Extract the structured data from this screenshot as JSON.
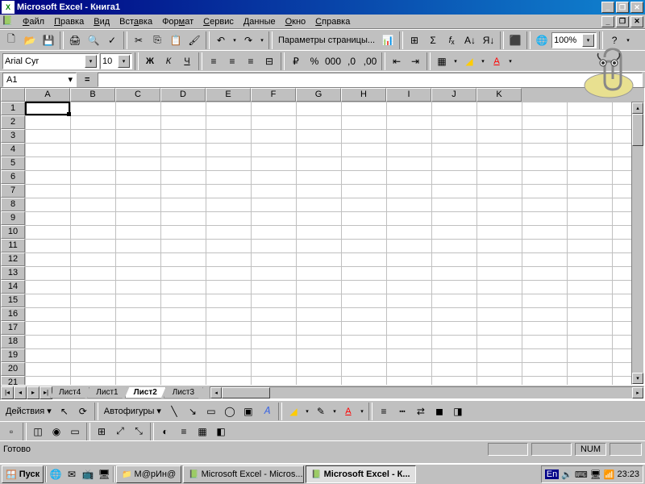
{
  "title": "Microsoft Excel - Книга1",
  "menus": [
    "Файл",
    "Правка",
    "Вид",
    "Вставка",
    "Формат",
    "Сервис",
    "Данные",
    "Окно",
    "Справка"
  ],
  "pageParams": "Параметры страницы...",
  "zoom": "100%",
  "font": {
    "name": "Arial Cyr",
    "size": "10"
  },
  "namebox": "A1",
  "columns": [
    "A",
    "B",
    "C",
    "D",
    "E",
    "F",
    "G",
    "H",
    "I",
    "J",
    "K"
  ],
  "rows": [
    "1",
    "2",
    "3",
    "4",
    "5",
    "6",
    "7",
    "8",
    "9",
    "10",
    "11",
    "12",
    "13",
    "14",
    "15",
    "16",
    "17",
    "18",
    "19",
    "20",
    "21"
  ],
  "sheets": [
    "Лист4",
    "Лист1",
    "Лист2",
    "Лист3"
  ],
  "activeSheet": "Лист2",
  "drawing": {
    "actions": "Действия",
    "autoshapes": "Автофигуры"
  },
  "status": {
    "ready": "Готово",
    "num": "NUM"
  },
  "taskbar": {
    "start": "Пуск",
    "folder": "М@рИн@",
    "task1": "Microsoft Excel - Micros...",
    "task2": "Microsoft Excel - К...",
    "lang": "En",
    "time": "23:23"
  }
}
